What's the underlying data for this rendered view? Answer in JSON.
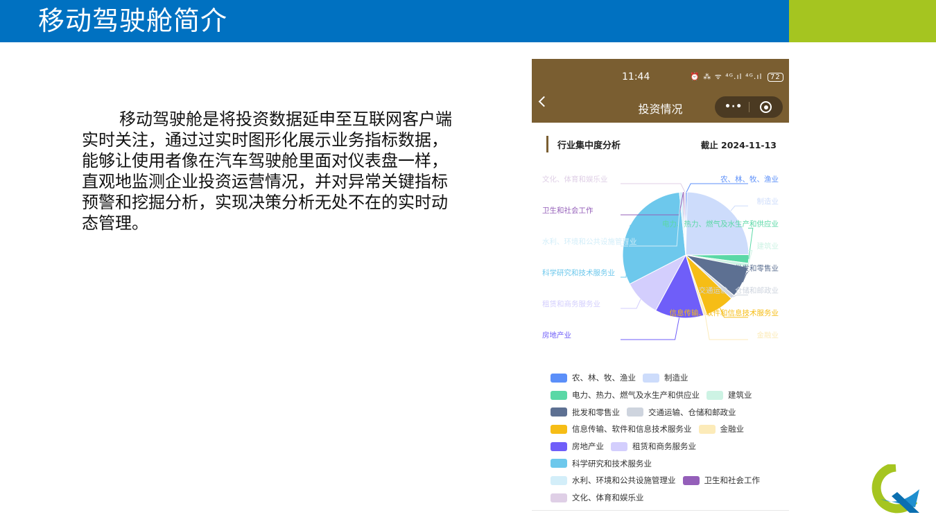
{
  "slide": {
    "title": "移动驾驶舱简介",
    "intro": "移动驾驶舱是将投资数据延申至互联网客户端实时关注，通过过实时图形化展示业务指标数据，能够让使用者像在汽车驾驶舱里面对仪表盘一样，直观地监测企业投资运营情况，并对异常关键指标预警和挖掘分析，实现决策分析无处不在的实时动态管理。"
  },
  "phone": {
    "status_time": "11:44",
    "status_icons": "⏰ ⁂ ᯤ ⁴ᴳ.ıl ⁴ᴳ.ıl",
    "battery": "72",
    "nav_title": "投资情况",
    "more_icon": "•·•",
    "section_title": "行业集中度分析",
    "section_date": "截止 2024-11-13"
  },
  "chart_data": {
    "type": "pie",
    "title": "行业集中度分析",
    "slices": [
      {
        "name": "农、林、牧、渔业",
        "value": 0.4,
        "color": "#5b8ff9"
      },
      {
        "name": "制造业",
        "value": 24.5,
        "color": "#cddcfb"
      },
      {
        "name": "电力、热力、燃气及水生产和供应业",
        "value": 2.2,
        "color": "#5ad8a6"
      },
      {
        "name": "建筑业",
        "value": 1.0,
        "color": "#cdf3e4"
      },
      {
        "name": "批发和零售业",
        "value": 8.0,
        "color": "#5d7092"
      },
      {
        "name": "交通运输、仓储和邮政业",
        "value": 1.0,
        "color": "#ced4de"
      },
      {
        "name": "信息传输、软件和信息技术服务业",
        "value": 7.5,
        "color": "#f6bd16"
      },
      {
        "name": "金融业",
        "value": 0.8,
        "color": "#fcebb9"
      },
      {
        "name": "房地产业",
        "value": 12.5,
        "color": "#6f5ef9"
      },
      {
        "name": "租赁和商务服务业",
        "value": 9.5,
        "color": "#d3cefd"
      },
      {
        "name": "科学研究和技术服务业",
        "value": 31.0,
        "color": "#6dc8ec"
      },
      {
        "name": "水利、环境和公共设施管理业",
        "value": 0.8,
        "color": "#d3eef9"
      },
      {
        "name": "卫生和社会工作",
        "value": 0.4,
        "color": "#945fb9"
      },
      {
        "name": "文化、体育和娱乐业",
        "value": 0.4,
        "color": "#dfcfe6"
      }
    ],
    "legend_position": "bottom"
  },
  "legend_rows": [
    [
      "农、林、牧、渔业",
      "制造业"
    ],
    [
      "电力、热力、燃气及水生产和供应业",
      "建筑业"
    ],
    [
      "批发和零售业",
      "交通运输、仓储和邮政业"
    ],
    [
      "信息传输、软件和信息技术服务业",
      "金融业"
    ],
    [
      "房地产业",
      "租赁和商务服务业"
    ],
    [
      "科学研究和技术服务业"
    ],
    [
      "水利、环境和公共设施管理业",
      "卫生和社会工作"
    ],
    [
      "文化、体育和娱乐业"
    ]
  ],
  "colors": {
    "header_blue": "#0071c1",
    "header_green": "#a5c520",
    "phone_brown": "#7a5e31"
  }
}
